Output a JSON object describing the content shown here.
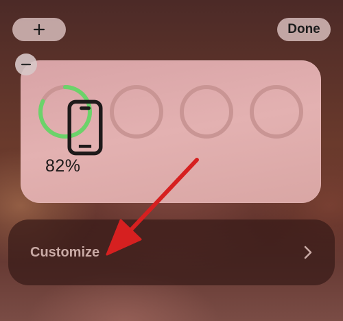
{
  "colors": {
    "battery_ring": "#6bd36a",
    "empty_ring": "#c99594",
    "arrow": "#d62020",
    "widget_bg": "#dfabab"
  },
  "toolbar": {
    "add_icon": "plus-icon",
    "done_label": "Done"
  },
  "widget": {
    "remove_icon": "minus-icon",
    "battery": {
      "device_icon": "iphone-icon",
      "level": 0.82,
      "percent_label": "82%"
    },
    "empty_slots": 3
  },
  "customize": {
    "label": "Customize",
    "chevron_icon": "chevron-right-icon"
  },
  "annotation": {
    "icon": "red-arrow-pointer"
  }
}
